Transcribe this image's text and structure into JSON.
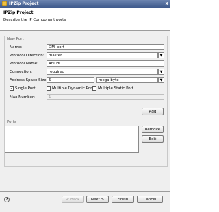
{
  "window": {
    "title": "IPZip Project",
    "close_glyph": "x"
  },
  "header": {
    "title": "IPZip Project",
    "description": "Describe the IP Component ports"
  },
  "new_port": {
    "section_title": "New Port",
    "name_label": "Name:",
    "name_value": "DM_port",
    "direction_label": "Protocol Direction:",
    "direction_value": "master",
    "protocol_name_label": "Protocol Name:",
    "protocol_name_value": "AnCHC",
    "connection_label": "Connection:",
    "connection_value": "required",
    "address_label": "Address Space Size:",
    "address_value": "5",
    "address_unit_value": "mega byte",
    "single_port_label": "Single Port",
    "single_port_checked": true,
    "multi_dynamic_label": "Multiple Dynamic Port",
    "multi_dynamic_checked": false,
    "multi_static_label": "Multiple Static Port",
    "multi_static_checked": false,
    "max_number_label": "Max Number:",
    "max_number_value": "1",
    "add_label": "Add"
  },
  "ports": {
    "section_title": "Ports",
    "remove_label": "Remove",
    "edit_label": "Edit"
  },
  "footer": {
    "help_glyph": "?",
    "back_label": "< Back",
    "next_label": "Next >",
    "finish_label": "Finish",
    "cancel_label": "Cancel"
  },
  "icons": {
    "check_glyph": "✓",
    "dropdown_glyph": "▼"
  }
}
